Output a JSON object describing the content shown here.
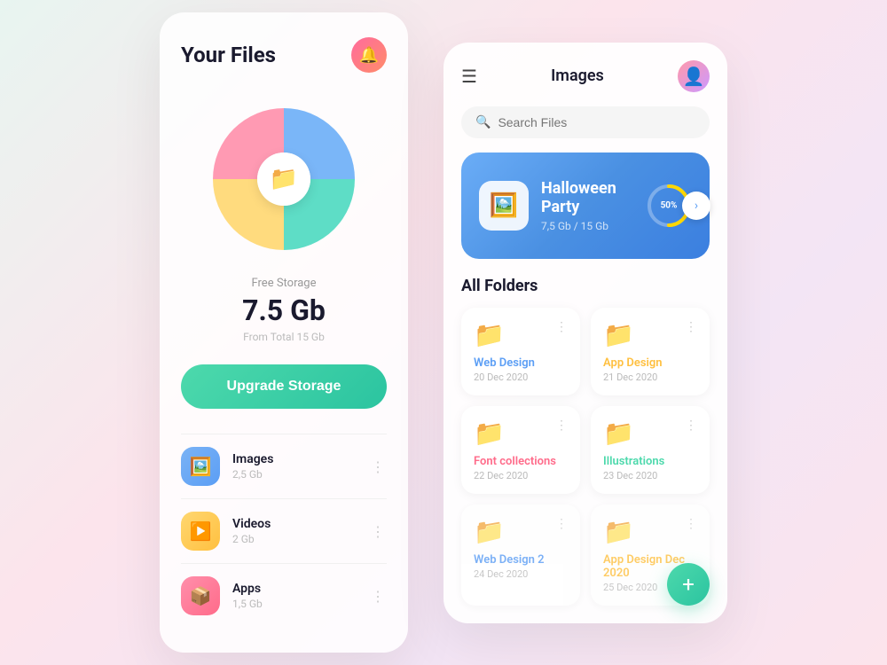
{
  "left_card": {
    "title": "Your Files",
    "notification_icon": "🔔",
    "storage": {
      "label": "Free Storage",
      "value": "7.5 Gb",
      "total_label": "From Total 15 Gb"
    },
    "upgrade_btn": "Upgrade Storage",
    "pie_icon": "📁",
    "files": [
      {
        "name": "Images",
        "size": "2,5 Gb",
        "icon": "🖼️",
        "color": "blue"
      },
      {
        "name": "Videos",
        "size": "2 Gb",
        "icon": "▶️",
        "color": "yellow"
      },
      {
        "name": "Apps",
        "size": "1,5 Gb",
        "icon": "📦",
        "color": "pink"
      }
    ]
  },
  "right_card": {
    "title": "Images",
    "search_placeholder": "Search Files",
    "featured": {
      "name": "Halloween Party",
      "sub": "7,5 Gb / 15 Gb",
      "progress_label": "50%"
    },
    "all_folders_title": "All Folders",
    "folders": [
      {
        "name": "Web Design",
        "date": "20 Dec 2020",
        "color": "blue",
        "icon_color": "#5b9ef5"
      },
      {
        "name": "App Design",
        "date": "21 Dec 2020",
        "color": "yellow",
        "icon_color": "#ffc040"
      },
      {
        "name": "Font collections",
        "date": "22 Dec 2020",
        "color": "pink",
        "icon_color": "#ff6b8a"
      },
      {
        "name": "Illustrations",
        "date": "23 Dec 2020",
        "color": "teal",
        "icon_color": "#4dd9ac"
      },
      {
        "name": "Web Design 2",
        "date": "24 Dec 2020",
        "color": "blue",
        "icon_color": "#5b9ef5"
      },
      {
        "name": "App Design Dec 2020",
        "date": "25 Dec 2020",
        "color": "yellow",
        "icon_color": "#ffc040"
      }
    ],
    "fab_label": "+"
  }
}
